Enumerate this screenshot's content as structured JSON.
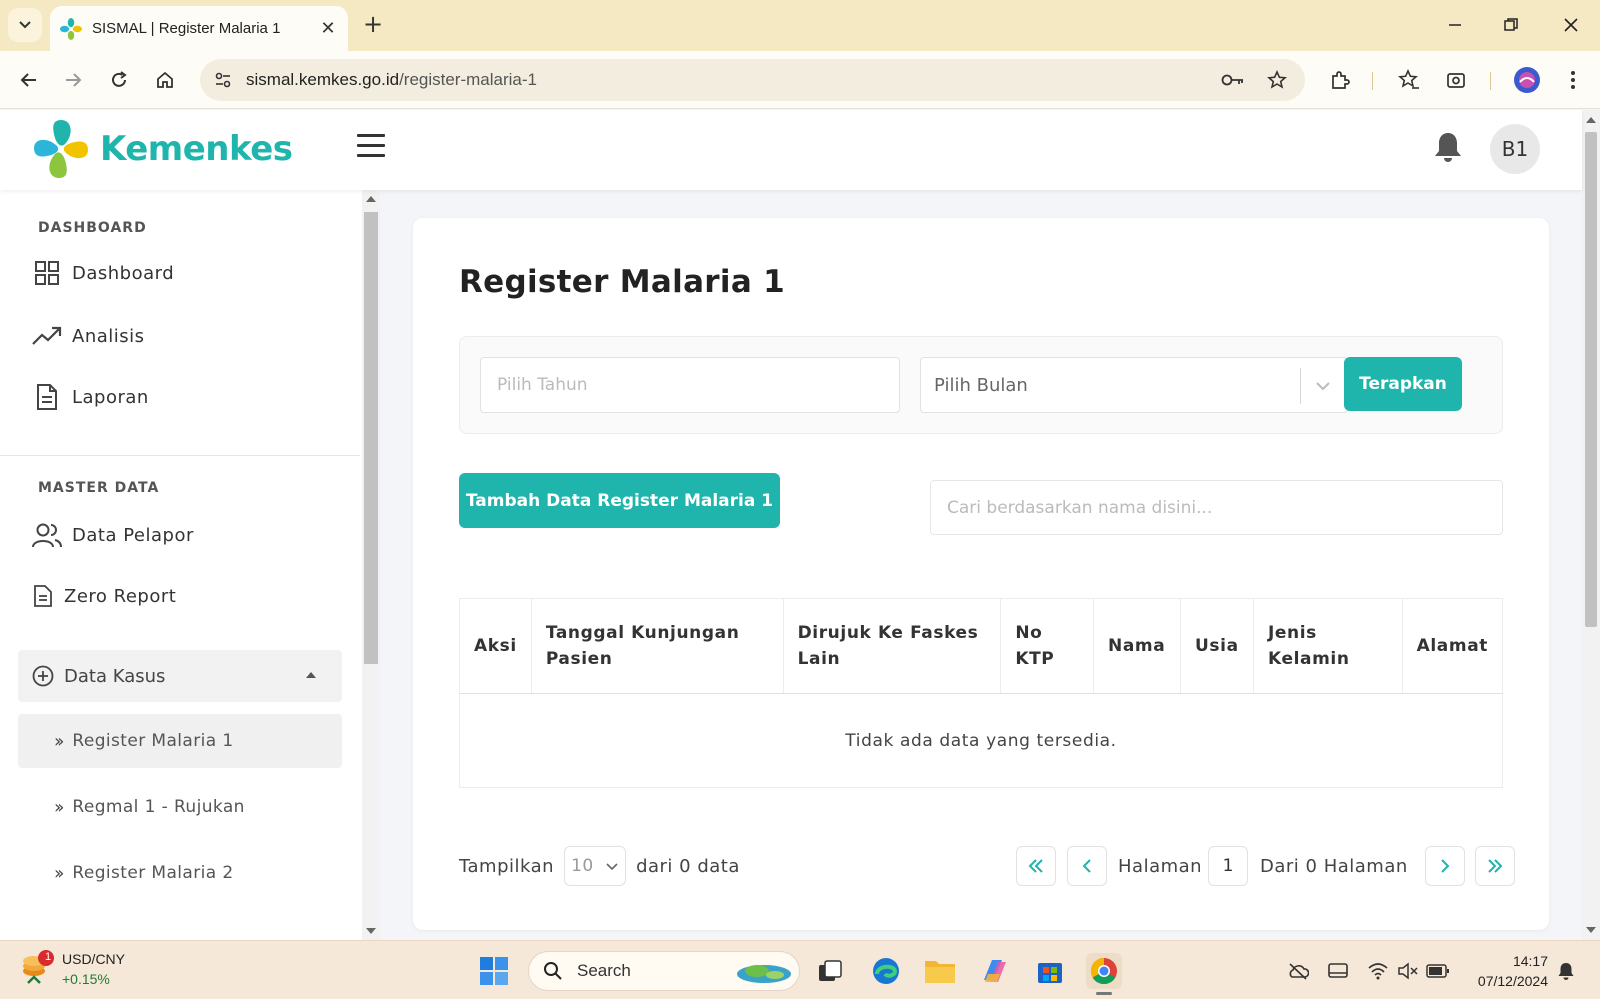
{
  "browser": {
    "tab_title": "SISMAL | Register Malaria 1",
    "url_host": "sismal.kemkes.go.id",
    "url_path": "/register-malaria-1"
  },
  "header": {
    "logo_text": "Kemenkes",
    "avatar_initials": "B1"
  },
  "sidebar": {
    "section_dashboard": "DASHBOARD",
    "dashboard": "Dashboard",
    "analisis": "Analisis",
    "laporan": "Laporan",
    "section_master": "MASTER DATA",
    "data_pelapor": "Data Pelapor",
    "zero_report": "Zero Report",
    "data_kasus": "Data Kasus",
    "sub_items": [
      "Register Malaria 1",
      "Regmal 1 - Rujukan",
      "Register Malaria 2"
    ]
  },
  "main": {
    "title": "Register Malaria 1",
    "year_placeholder": "Pilih Tahun",
    "month_select": "Pilih Bulan",
    "apply_button": "Terapkan",
    "add_button": "Tambah Data Register Malaria 1",
    "search_placeholder": "Cari berdasarkan nama disini...",
    "table": {
      "columns": [
        "Aksi",
        "Tanggal Kunjungan Pasien",
        "Dirujuk Ke Faskes Lain",
        "No KTP",
        "Nama",
        "Usia",
        "Jenis Kelamin",
        "Alamat"
      ],
      "empty_message": "Tidak ada data yang tersedia."
    },
    "pagination": {
      "show_label": "Tampilkan",
      "page_size": "10",
      "total_label": "dari 0 data",
      "page_label": "Halaman",
      "current_page": "1",
      "of_pages_label": "Dari 0 Halaman"
    }
  },
  "taskbar": {
    "widget_title": "USD/CNY",
    "widget_change": "+0.15%",
    "widget_badge": "1",
    "search_label": "Search",
    "time": "14:17",
    "date": "07/12/2024"
  },
  "colors": {
    "brand": "#1fb5ac",
    "tabbar": "#f5e9c4",
    "taskbar": "#f6e8d8"
  }
}
